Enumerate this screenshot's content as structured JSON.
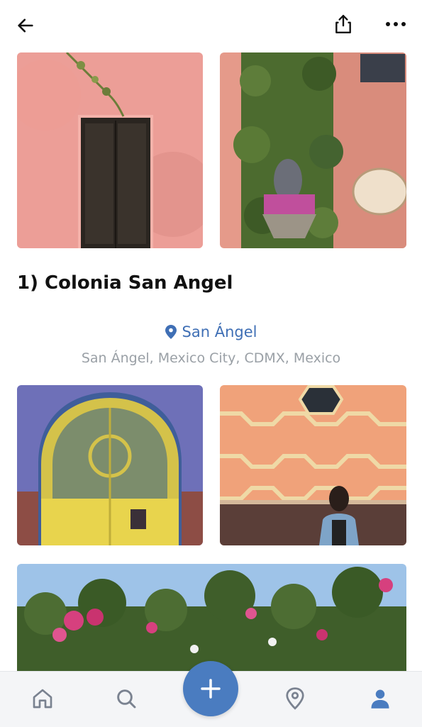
{
  "header": {
    "back_icon": "arrow-left-icon",
    "share_icon": "share-icon",
    "more_icon": "more-horizontal-icon"
  },
  "section": {
    "title": "1) Colonia San Angel"
  },
  "location": {
    "pin_icon": "map-pin-icon",
    "name": "San Ángel",
    "address": "San Ángel, Mexico City, CDMX, Mexico"
  },
  "photos": [
    {
      "subject": "pink wall with dark wooden door"
    },
    {
      "subject": "ivy-covered wall with Virgin shrine and house number plaque"
    },
    {
      "subject": "blue arch with yellow ornate iron gate"
    },
    {
      "subject": "coral tiled wall with woman in denim jacket"
    },
    {
      "subject": "bougainvillea hedge under blue sky"
    }
  ],
  "tabbar": {
    "home_icon": "home-icon",
    "search_icon": "search-icon",
    "add_icon": "plus-icon",
    "map_icon": "map-pin-icon",
    "profile_icon": "user-icon"
  },
  "colors": {
    "accent": "#4a7cc0",
    "link": "#3f6fb5",
    "muted": "#9aa0a6",
    "tab_inactive": "#7a8290"
  }
}
